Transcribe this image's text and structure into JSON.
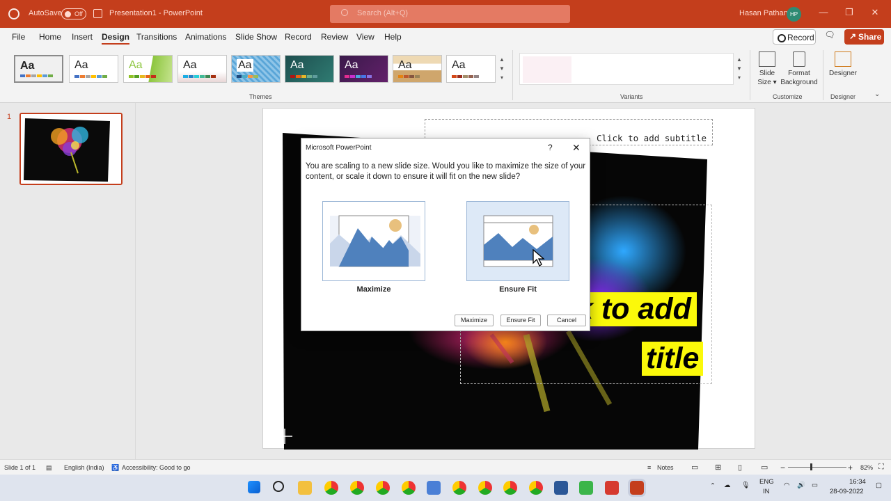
{
  "titlebar": {
    "autosave": "AutoSave",
    "toggle": "Off",
    "doc_title": "Presentation1  -  PowerPoint",
    "search_placeholder": "Search (Alt+Q)",
    "user_name": "Hasan Pathan",
    "avatar_initials": "HP"
  },
  "menu": {
    "tabs": [
      "File",
      "Home",
      "Insert",
      "Design",
      "Transitions",
      "Animations",
      "Slide Show",
      "Record",
      "Review",
      "View",
      "Help"
    ],
    "active": "Design",
    "record": "Record",
    "share": "Share"
  },
  "ribbon": {
    "themes_label": "Themes",
    "variants_label": "Variants",
    "customize_label": "Customize",
    "designer_group_label": "Designer",
    "theme_sample": "Aa",
    "slide_size": "Slide\nSize",
    "format_background": "Format\nBackground",
    "designer": "Designer"
  },
  "thumbnail": {
    "number": "1"
  },
  "slide": {
    "subtitle_placeholder": "Click to add subtitle",
    "title_line1": "k to add",
    "title_line2": "title"
  },
  "dialog": {
    "title": "Microsoft PowerPoint",
    "help": "?",
    "close": "✕",
    "message": "You are scaling to a new slide size.  Would you like to maximize the size of your content, or scale it down to ensure it will fit on the new slide?",
    "option_maximize": "Maximize",
    "option_ensure_fit": "Ensure Fit",
    "btn_maximize": "Maximize",
    "btn_ensure_fit": "Ensure Fit",
    "btn_cancel": "Cancel"
  },
  "status": {
    "slide": "Slide 1 of 1",
    "language": "English (India)",
    "accessibility": "Accessibility: Good to go",
    "notes": "Notes",
    "zoom": "82%"
  },
  "taskbar": {
    "lang1": "ENG",
    "lang2": "IN",
    "time": "16:34",
    "date": "28-09-2022"
  },
  "colors": {
    "accent": "#c43e1c",
    "highlight": "#fbf90a"
  }
}
